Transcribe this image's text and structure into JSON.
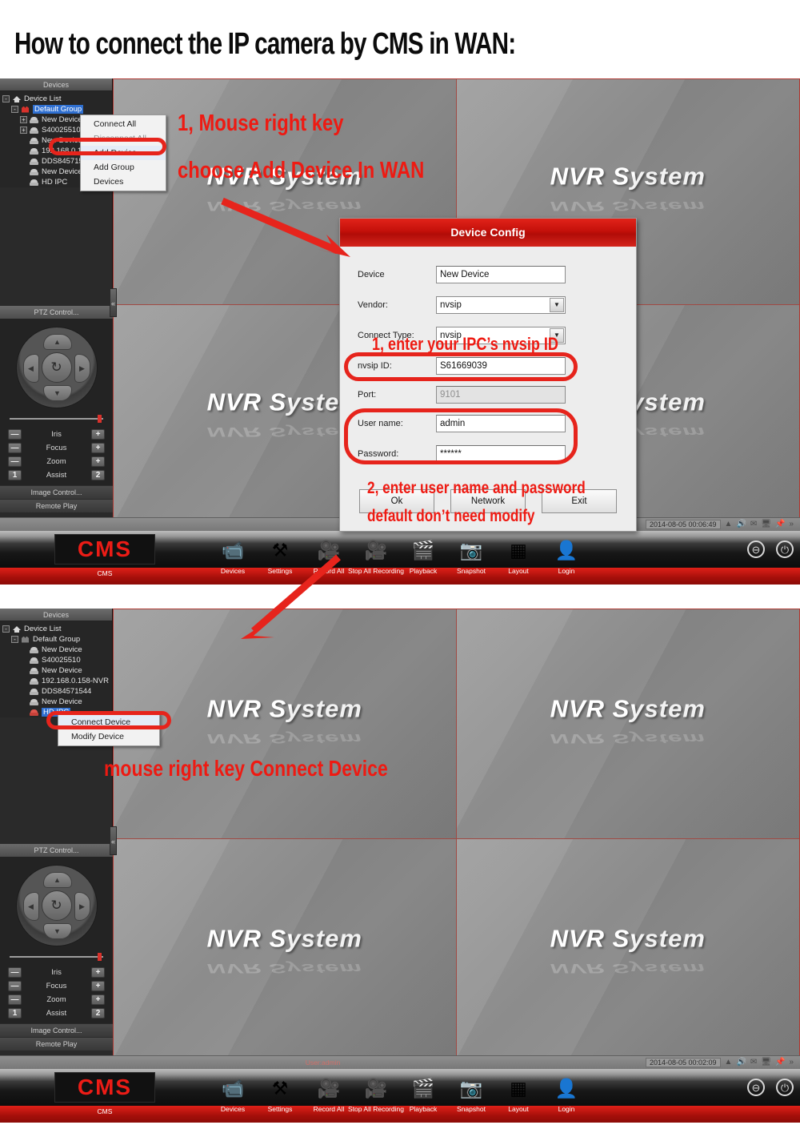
{
  "page": {
    "title": "How to connect the IP camera by CMS in WAN:"
  },
  "panels": {
    "devices_header": "Devices",
    "ptz_header": "PTZ Control...",
    "image_control": "Image Control...",
    "remote_play": "Remote Play"
  },
  "tree": {
    "root": "Device List",
    "group": "Default Group",
    "devices": [
      "New Device",
      "S40025510",
      "New Device",
      "192.168.0.158-NVR",
      "DDS84571544",
      "New Device",
      "HD IPC"
    ]
  },
  "ptz": {
    "rows": [
      {
        "minus": "—",
        "name": "Iris",
        "plus": "+"
      },
      {
        "minus": "—",
        "name": "Focus",
        "plus": "+"
      },
      {
        "minus": "—",
        "name": "Zoom",
        "plus": "+"
      },
      {
        "minus": "1",
        "name": "Assist",
        "plus": "2"
      }
    ],
    "center_icon": "↻",
    "up": "▲",
    "down": "▼",
    "left": "◀",
    "right": "▶"
  },
  "video": {
    "watermark": "NVR System"
  },
  "context_menu_1": {
    "items": [
      {
        "label": "Connect All",
        "state": "normal"
      },
      {
        "label": "Disconnect All",
        "state": "dim"
      },
      {
        "label": "Add Device",
        "state": "highlight"
      },
      {
        "label": "Add Group",
        "state": "normal"
      },
      {
        "label": "Devices",
        "state": "normal"
      }
    ]
  },
  "context_menu_2": {
    "items": [
      {
        "label": "Connect Device",
        "state": "highlight"
      },
      {
        "label": "Modify Device",
        "state": "normal"
      }
    ]
  },
  "dialog": {
    "title": "Device Config",
    "fields": {
      "device_label": "Device",
      "device_value": "New Device",
      "vendor_label": "Vendor:",
      "vendor_value": "nvsip",
      "connect_type_label": "Connect Type:",
      "connect_type_value": "nvsip",
      "nvsip_label": "nvsip ID:",
      "nvsip_value": "S61669039",
      "port_label": "Port:",
      "port_value": "9101",
      "user_label": "User name:",
      "user_value": "admin",
      "password_label": "Password:",
      "password_value": "******"
    },
    "buttons": {
      "ok": "Ok",
      "network": "Network",
      "exit": "Exit"
    },
    "dropdown_arrow": "▼"
  },
  "toolbar": {
    "brand": "CMS",
    "brand_label": "CMS",
    "items": [
      {
        "label": "Devices",
        "icon": "camcorder-icon",
        "glyph": "📹"
      },
      {
        "label": "Settings",
        "icon": "tools-icon",
        "glyph": "⚒"
      },
      {
        "label": "Record All",
        "icon": "record-icon",
        "glyph": "🎥"
      },
      {
        "label": "Stop All Recording",
        "icon": "stop-record-icon",
        "glyph": "🎥"
      },
      {
        "label": "Playback",
        "icon": "playback-icon",
        "glyph": "🎬"
      },
      {
        "label": "Snapshot",
        "icon": "snapshot-icon",
        "glyph": "📷"
      },
      {
        "label": "Layout",
        "icon": "layout-icon",
        "glyph": "▦"
      },
      {
        "label": "Login",
        "icon": "user-icon",
        "glyph": "👤"
      }
    ],
    "minimize": "⊖",
    "power": "⏻"
  },
  "status_bar_1": {
    "user": "",
    "time": "2014-08-05 00:06:49"
  },
  "status_bar_2": {
    "user": "User:admin",
    "time": "2014-08-05 00:02:09"
  },
  "tray_icons": [
    "eject-icon",
    "mute-icon",
    "mail-icon",
    "network-icon",
    "pin-icon",
    "chevrons-icon"
  ],
  "annotations": {
    "a1": "1, Mouse right key",
    "a2": "choose Add Device In WAN",
    "a3": "1, enter your IPC’s nvsip ID",
    "a4": "2, enter user name and password",
    "a5": "default don’t need modify",
    "a6": "mouse right key Connect Device"
  },
  "colors": {
    "accent_red": "#ee1a12",
    "dialog_red": "#c3100a",
    "toolbar_red": "#a40f0a",
    "selection_blue": "#2f6fd0",
    "panel_dark": "#2a2a2a"
  }
}
